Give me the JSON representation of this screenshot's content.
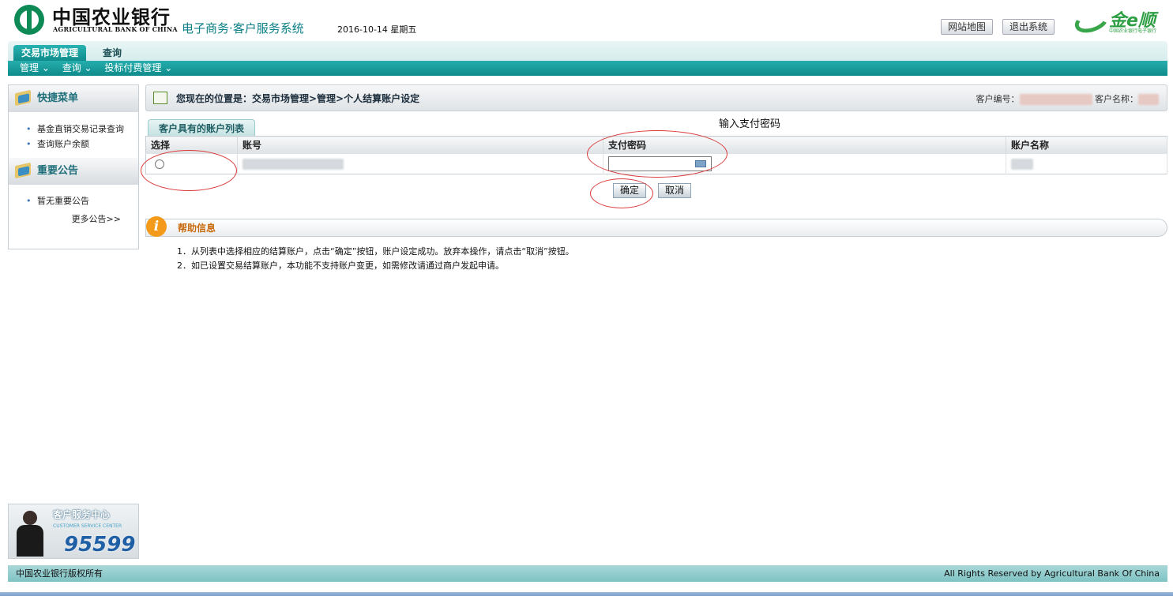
{
  "header": {
    "bank_name_cn": "中国农业银行",
    "bank_name_en": "AGRICULTURAL BANK OF CHINA",
    "system_name": "电子商务·客户服务系统",
    "date": "2016-10-14 星期五",
    "btn_sitemap": "网站地图",
    "btn_logout": "退出系统",
    "brand_text": "金e顺",
    "brand_sub": "中国农业银行电子银行"
  },
  "nav": {
    "tabs": [
      "交易市场管理",
      "查询"
    ],
    "subnav": [
      "管理 ⌄",
      "查询 ⌄",
      "投标付费管理 ⌄"
    ]
  },
  "sidebar": {
    "quick_title": "快捷菜单",
    "quick_items": [
      "基金直销交易记录查询",
      "查询账户余额"
    ],
    "notice_title": "重要公告",
    "notice_items": [
      "暂无重要公告"
    ],
    "more": "更多公告>>"
  },
  "service_center": {
    "title_cn": "客户服务中心",
    "title_en": "CUSTOMER SERVICE CENTER",
    "hotline": "95599"
  },
  "main": {
    "location": "您现在的位置是：交易市场管理>管理>个人结算账户设定",
    "cust_no_label": "客户编号：",
    "cust_name_label": "客户名称：",
    "account_tab": "客户具有的账户列表",
    "columns": [
      "选择",
      "账号",
      "支付密码",
      "账户名称"
    ],
    "confirm": "确定",
    "cancel": "取消"
  },
  "annotation": {
    "text": "输入支付密码"
  },
  "help": {
    "title": "帮助信息",
    "line1": "1．从列表中选择相应的结算账户，点击“确定”按钮，账户设定成功。放弃本操作，请点击“取消”按钮。",
    "line2": "2．如已设置交易结算账户，本功能不支持账户变更，如需修改请通过商户发起申请。"
  },
  "footer": {
    "left": "中国农业银行版权所有",
    "right": "All Rights Reserved by Agricultural Bank Of China"
  }
}
